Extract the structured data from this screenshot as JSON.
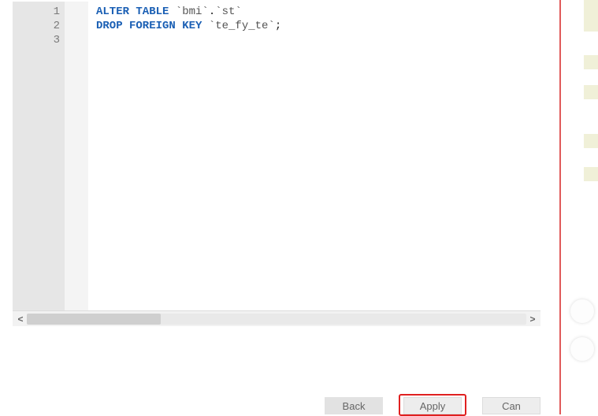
{
  "editor": {
    "line_numbers": [
      "1",
      "2",
      "3"
    ],
    "lines": [
      {
        "segments": [
          {
            "t": "kw",
            "v": "ALTER TABLE"
          },
          {
            "t": "plain",
            "v": " "
          },
          {
            "t": "bt",
            "v": "`bmi`"
          },
          {
            "t": "plain",
            "v": "."
          },
          {
            "t": "bt",
            "v": "`st`"
          }
        ]
      },
      {
        "segments": [
          {
            "t": "kw",
            "v": "DROP FOREIGN KEY"
          },
          {
            "t": "plain",
            "v": " "
          },
          {
            "t": "bt",
            "v": "`te_fy_te`"
          },
          {
            "t": "plain",
            "v": ";"
          }
        ]
      },
      {
        "segments": []
      }
    ],
    "scroll": {
      "left_arrow": "<",
      "right_arrow": ">"
    }
  },
  "buttons": {
    "back": "Back",
    "apply": "Apply",
    "cancel": "Can"
  }
}
